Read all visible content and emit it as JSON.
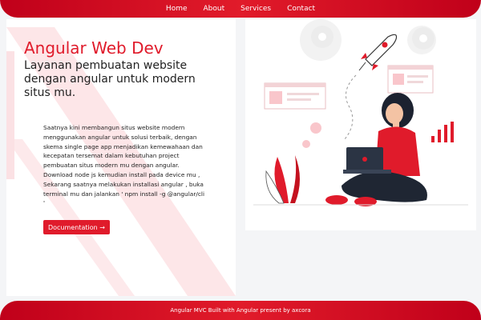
{
  "nav": {
    "items": [
      {
        "label": "Home"
      },
      {
        "label": "About"
      },
      {
        "label": "Services"
      },
      {
        "label": "Contact"
      }
    ]
  },
  "hero": {
    "title": "Angular Web Dev",
    "subtitle": "Layanan pembuatan website dengan angular untuk modern situs mu.",
    "description": "Saatnya kini membangun situs website modern menggunakan angular untuk solusi terbaik, dengan skema single page app menjadikan kemewahaan dan kecepatan tersemat dalam kebutuhan project pembuatan situs modern mu dengan angular. Download node js kemudian install pada device mu , Sekarang saatnya melakukan installasi angular , buka terminal mu dan jalankan ' npm install -g @angular/cli '",
    "button_label": "Documentation →"
  },
  "illustration": {
    "icon": "woman-with-laptop-rocket-illustration"
  },
  "footer": {
    "text": "Angular MVC Built with Angular present by axcora"
  },
  "colors": {
    "accent": "#e01b2b",
    "nav_bg": "#c0001a"
  }
}
